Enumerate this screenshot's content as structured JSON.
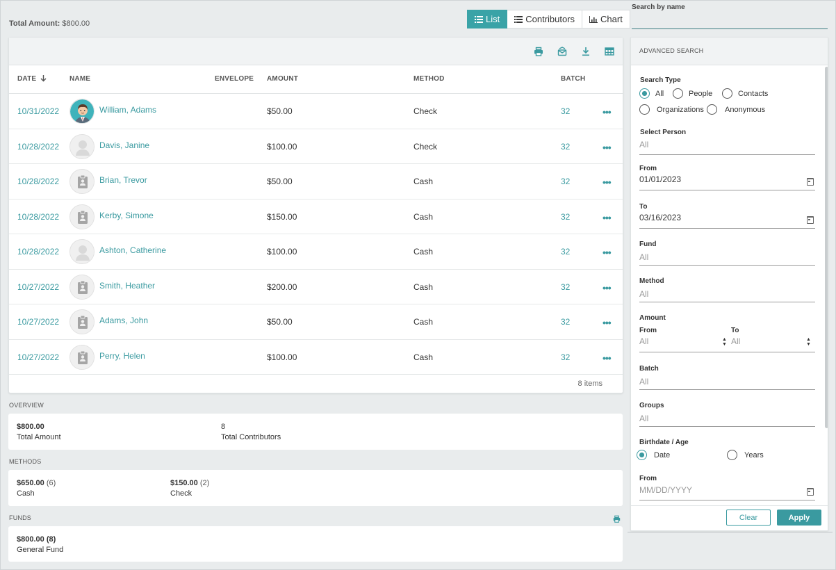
{
  "summary": {
    "total_amount_label": "Total Amount:",
    "total_amount_value": "$800.00"
  },
  "view_toggle": {
    "list": "List",
    "contributors": "Contributors",
    "chart": "Chart",
    "active": "List"
  },
  "toolbar_icons": [
    "print-icon",
    "mail-icon",
    "download-icon",
    "columns-icon"
  ],
  "grid": {
    "headers": {
      "date": "DATE",
      "name": "NAME",
      "envelope": "ENVELOPE",
      "amount": "AMOUNT",
      "method": "METHOD",
      "batch": "BATCH"
    },
    "sort": "date-descending",
    "rows": [
      {
        "date": "10/31/2022",
        "name": "William, Adams",
        "envelope": "",
        "amount": "$50.00",
        "method": "Check",
        "batch": "32",
        "avatar": "photo"
      },
      {
        "date": "10/28/2022",
        "name": "Davis, Janine",
        "envelope": "",
        "amount": "$100.00",
        "method": "Check",
        "batch": "32",
        "avatar": "person"
      },
      {
        "date": "10/28/2022",
        "name": "Brian, Trevor",
        "envelope": "",
        "amount": "$50.00",
        "method": "Cash",
        "batch": "32",
        "avatar": "badge"
      },
      {
        "date": "10/28/2022",
        "name": "Kerby, Simone",
        "envelope": "",
        "amount": "$150.00",
        "method": "Cash",
        "batch": "32",
        "avatar": "badge"
      },
      {
        "date": "10/28/2022",
        "name": "Ashton, Catherine",
        "envelope": "",
        "amount": "$100.00",
        "method": "Cash",
        "batch": "32",
        "avatar": "person"
      },
      {
        "date": "10/27/2022",
        "name": "Smith, Heather",
        "envelope": "",
        "amount": "$200.00",
        "method": "Cash",
        "batch": "32",
        "avatar": "badge"
      },
      {
        "date": "10/27/2022",
        "name": "Adams, John",
        "envelope": "",
        "amount": "$50.00",
        "method": "Cash",
        "batch": "32",
        "avatar": "badge"
      },
      {
        "date": "10/27/2022",
        "name": "Perry, Helen",
        "envelope": "",
        "amount": "$100.00",
        "method": "Cash",
        "batch": "32",
        "avatar": "badge"
      }
    ],
    "item_count": "8 items"
  },
  "overview": {
    "label": "OVERVIEW",
    "total_amount_value": "$800.00",
    "total_amount_label": "Total Amount",
    "total_contributors_value": "8",
    "total_contributors_label": "Total Contributors"
  },
  "methods": {
    "label": "METHODS",
    "items": [
      {
        "amount": "$650.00",
        "count": "(6)",
        "name": "Cash"
      },
      {
        "amount": "$150.00",
        "count": "(2)",
        "name": "Check"
      }
    ]
  },
  "funds": {
    "label": "FUNDS",
    "items": [
      {
        "amount": "$800.00",
        "count": "(8)",
        "name": "General Fund"
      }
    ]
  },
  "search": {
    "label": "Search by name",
    "value": ""
  },
  "advanced_search": {
    "title": "ADVANCED SEARCH",
    "search_type_label": "Search Type",
    "search_type_options": [
      "All",
      "People",
      "Contacts",
      "Organizations",
      "Anonymous"
    ],
    "search_type_selected": "All",
    "select_person_label": "Select Person",
    "select_person_value": "All",
    "from_label": "From",
    "from_value": "01/01/2023",
    "to_label": "To",
    "to_value": "03/16/2023",
    "fund_label": "Fund",
    "fund_value": "All",
    "method_label": "Method",
    "method_value": "All",
    "amount_label": "Amount",
    "amount_from_label": "From",
    "amount_from_value": "All",
    "amount_to_label": "To",
    "amount_to_value": "All",
    "batch_label": "Batch",
    "batch_value": "All",
    "groups_label": "Groups",
    "groups_value": "All",
    "birthdate_label": "Birthdate / Age",
    "birthdate_options": [
      "Date",
      "Years"
    ],
    "birthdate_selected": "Date",
    "birth_from_label": "From",
    "birth_from_placeholder": "MM/DD/YYYY",
    "clear_label": "Clear",
    "apply_label": "Apply"
  },
  "colors": {
    "accent": "#3a9aa0",
    "active_button": "#3aa3a7",
    "background": "#e9eced"
  }
}
